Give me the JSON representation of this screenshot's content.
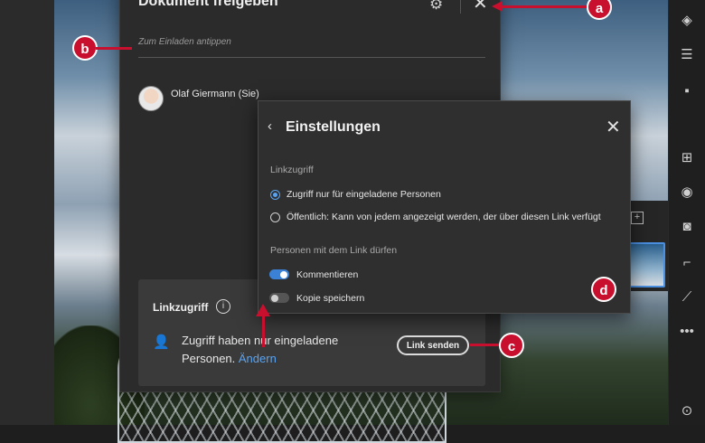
{
  "share_dialog": {
    "title": "Dokument freigeben",
    "invite_placeholder": "Zum Einladen antippen",
    "user_name": "Olaf Giermann (Sie)",
    "link_access": {
      "title": "Linkzugriff",
      "text_prefix": "Zugriff haben nur eingeladene Personen.",
      "change_link": "Ändern",
      "send_button": "Link senden"
    }
  },
  "settings": {
    "title": "Einstellungen",
    "link_access_label": "Linkzugriff",
    "options": [
      {
        "label": "Zugriff nur für eingeladene Personen",
        "selected": true
      },
      {
        "label": "Öffentlich: Kann von jedem angezeigt werden, der über diesen Link verfügt",
        "selected": false
      }
    ],
    "permissions_label": "Personen mit dem Link dürfen",
    "toggles": [
      {
        "label": "Kommentieren",
        "on": true
      },
      {
        "label": "Kopie speichern",
        "on": false
      }
    ]
  },
  "callouts": {
    "a": "a",
    "b": "b",
    "c": "c",
    "d": "d"
  },
  "colors": {
    "accent": "#5aa3f0",
    "callout": "#c8102e",
    "toggle_on": "#3b82d6"
  }
}
